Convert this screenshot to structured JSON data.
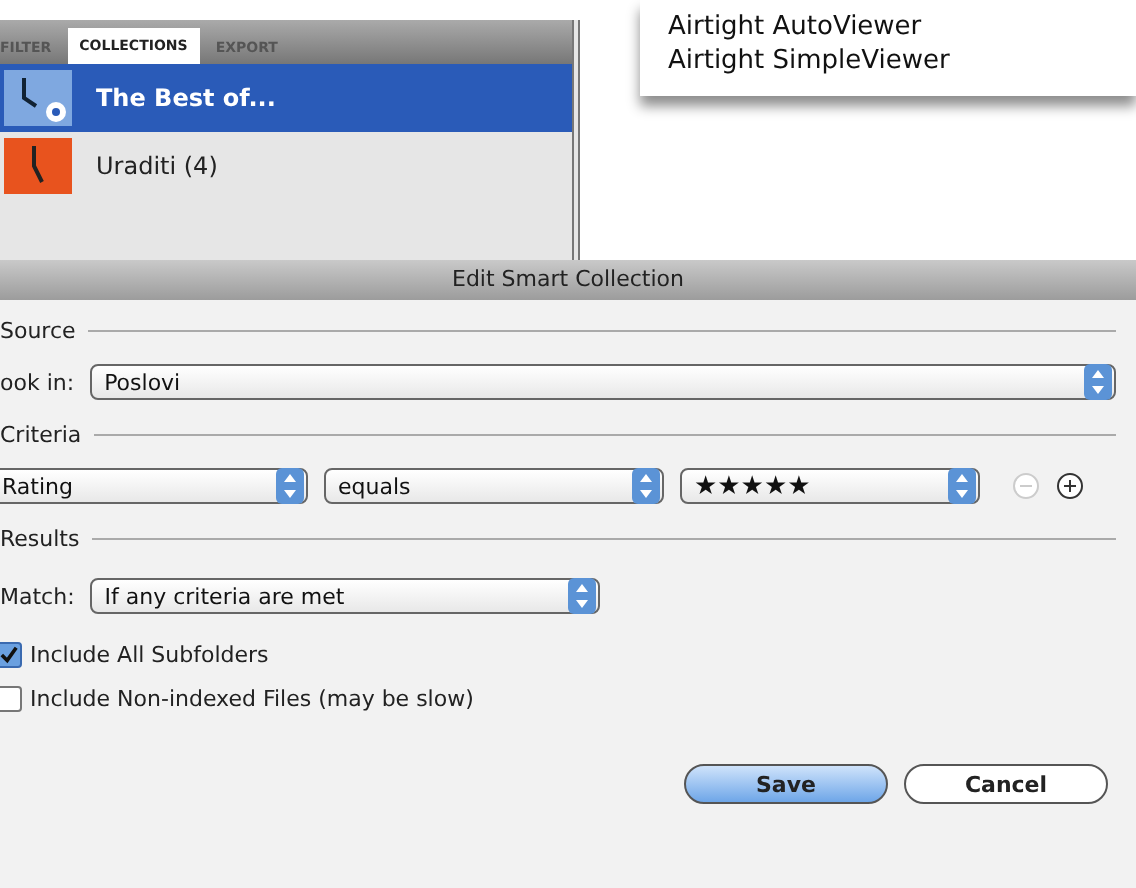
{
  "library_panel": {
    "tabs": [
      {
        "label": "FILTER",
        "selected": false
      },
      {
        "label": "COLLECTIONS",
        "selected": true
      },
      {
        "label": "EXPORT",
        "selected": false
      }
    ],
    "collections": [
      {
        "name": "The Best of...",
        "kind": "smart",
        "selected": true
      },
      {
        "name": "Uraditi (4)",
        "kind": "regular",
        "selected": false
      }
    ]
  },
  "menu": {
    "items": [
      "Airtight AutoViewer",
      "Airtight SimpleViewer"
    ]
  },
  "dialog": {
    "title": "Edit Smart Collection",
    "source": {
      "heading": "Source",
      "look_in_label": "ook in:",
      "look_in_value": "Poslovi"
    },
    "criteria": {
      "heading": "Criteria",
      "rows": [
        {
          "field": "Rating",
          "operator": "equals",
          "value": "★★★★★",
          "remove_disabled": true
        }
      ]
    },
    "results": {
      "heading": "Results",
      "match_label": "Match:",
      "match_value": "If any criteria are met",
      "options": [
        {
          "label": "Include All Subfolders",
          "checked": true
        },
        {
          "label": "Include Non-indexed Files (may be slow)",
          "checked": false
        }
      ]
    },
    "buttons": [
      {
        "label": "Save",
        "kind": "default"
      },
      {
        "label": "Cancel",
        "kind": "normal"
      }
    ]
  }
}
